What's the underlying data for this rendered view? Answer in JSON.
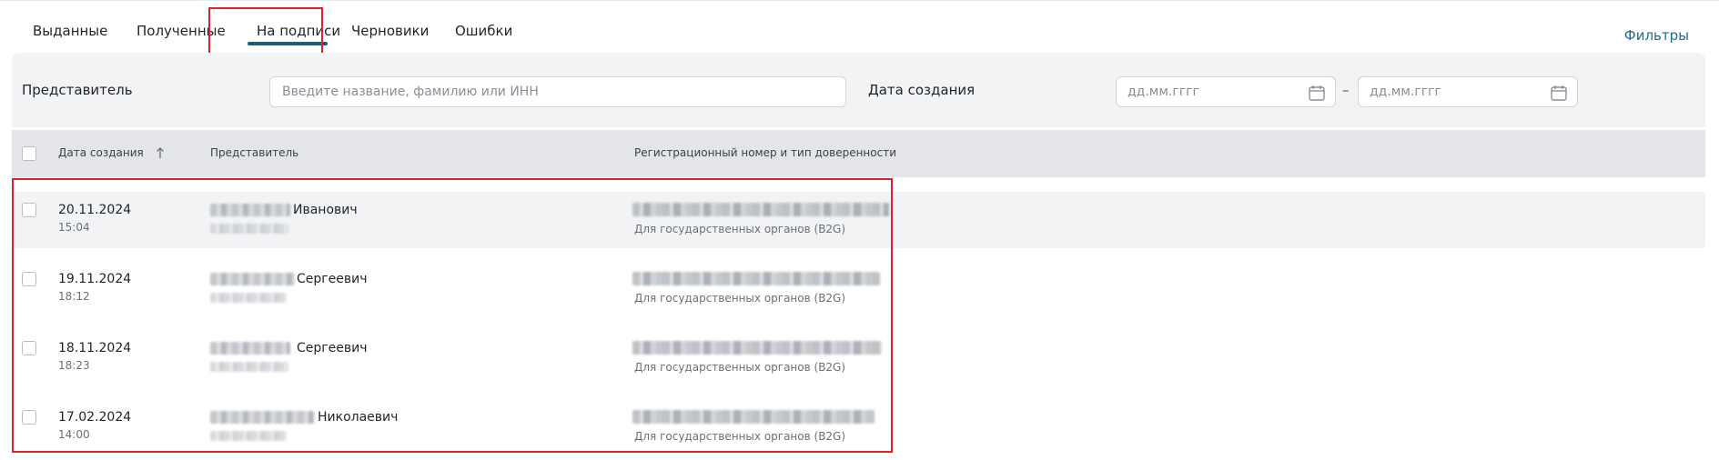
{
  "tabs": [
    {
      "label": "Выданные"
    },
    {
      "label": "Полученные"
    },
    {
      "label": "На подписи",
      "active": true
    },
    {
      "label": "Черновики"
    },
    {
      "label": "Ошибки"
    }
  ],
  "filters_link": "Фильтры",
  "filter_panel": {
    "representative_label": "Представитель",
    "representative_placeholder": "Введите название, фамилию или ИНН",
    "created_label": "Дата создания",
    "date_from_placeholder": "дд.мм.гггг",
    "date_to_placeholder": "дд.мм.гггг",
    "range_separator": "–"
  },
  "table": {
    "columns": {
      "created": "Дата создания",
      "representative": "Представитель",
      "registration": "Регистрационный номер и тип доверенности"
    },
    "rows": [
      {
        "date": "20.11.2024",
        "time": "15:04",
        "patronymic": "Иванович",
        "type": "Для государственных органов (B2G)"
      },
      {
        "date": "19.11.2024",
        "time": "18:12",
        "patronymic": "Сергеевич",
        "type": "Для государственных органов (B2G)"
      },
      {
        "date": "18.11.2024",
        "time": "18:23",
        "patronymic": "Сергеевич",
        "type": "Для государственных органов (B2G)"
      },
      {
        "date": "17.02.2024",
        "time": "14:00",
        "patronymic": "Николаевич",
        "type": "Для государственных органов (B2G)"
      }
    ]
  },
  "colors": {
    "accent": "#1b5e76",
    "link": "#1e6b8f",
    "highlight": "#e0202b"
  }
}
